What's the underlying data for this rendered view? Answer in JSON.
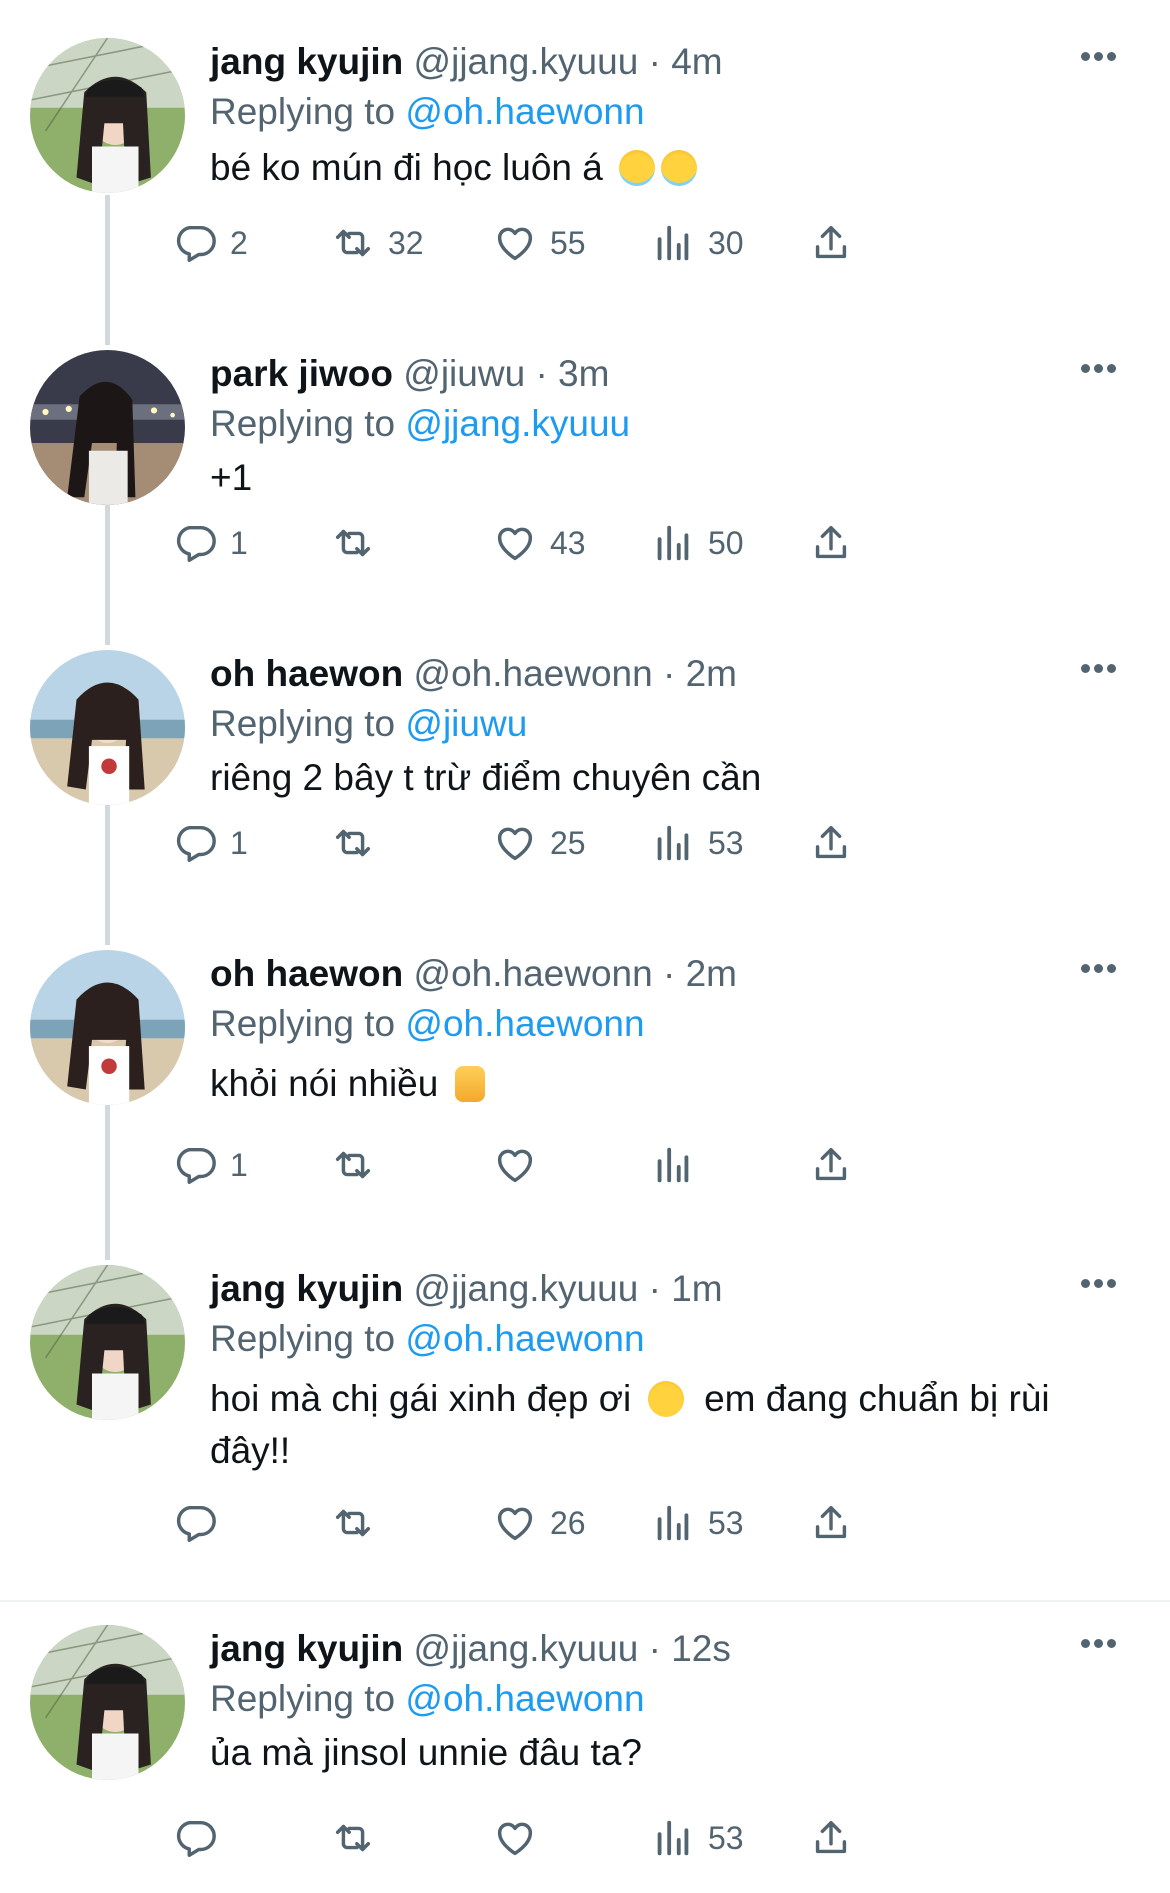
{
  "tweets": [
    {
      "name": "jang kyujin",
      "handle": "@jjang.kyuuu",
      "time": "4m",
      "reply_prefix": "Replying to",
      "reply_to": "@oh.haewonn",
      "text": "bé ko mún đi học luôn á",
      "reply_count": "2",
      "retweet_count": "32",
      "like_count": "55",
      "view_count": "30"
    },
    {
      "name": "park jiwoo",
      "handle": "@jiuwu",
      "time": "3m",
      "reply_prefix": "Replying to",
      "reply_to": "@jjang.kyuuu",
      "text": "+1",
      "reply_count": "1",
      "retweet_count": "",
      "like_count": "43",
      "view_count": "50"
    },
    {
      "name": "oh haewon",
      "handle": "@oh.haewonn",
      "time": "2m",
      "reply_prefix": "Replying to",
      "reply_to": "@jiuwu",
      "text": "riêng 2 bây t trừ điểm chuyên cần",
      "reply_count": "1",
      "retweet_count": "",
      "like_count": "25",
      "view_count": "53"
    },
    {
      "name": "oh haewon",
      "handle": "@oh.haewonn",
      "time": "2m",
      "reply_prefix": "Replying to",
      "reply_to": "@oh.haewonn",
      "text": "khỏi nói nhiều",
      "reply_count": "1",
      "retweet_count": "",
      "like_count": "",
      "view_count": ""
    },
    {
      "name": "jang kyujin",
      "handle": "@jjang.kyuuu",
      "time": "1m",
      "reply_prefix": "Replying to",
      "reply_to": "@oh.haewonn",
      "text_a": "hoi mà chị gái xinh đẹp ơi",
      "text_b": "em đang chuẩn bị rùi đây!!",
      "reply_count": "",
      "retweet_count": "",
      "like_count": "26",
      "view_count": "53"
    },
    {
      "name": "jang kyujin",
      "handle": "@jjang.kyuuu",
      "time": "12s",
      "reply_prefix": "Replying to",
      "reply_to": "@oh.haewonn",
      "text": "ủa mà jinsol unnie đâu ta?",
      "reply_count": "",
      "retweet_count": "",
      "like_count": "",
      "view_count": "53"
    }
  ],
  "icons": {
    "reply": "reply-icon",
    "retweet": "retweet-icon",
    "like": "heart-icon",
    "views": "views-icon",
    "share": "share-icon",
    "more": "more-icon"
  },
  "colors": {
    "link": "#1d9bf0",
    "secondary": "#536471",
    "text": "#0f1419",
    "thread_line": "#cfd9de"
  }
}
